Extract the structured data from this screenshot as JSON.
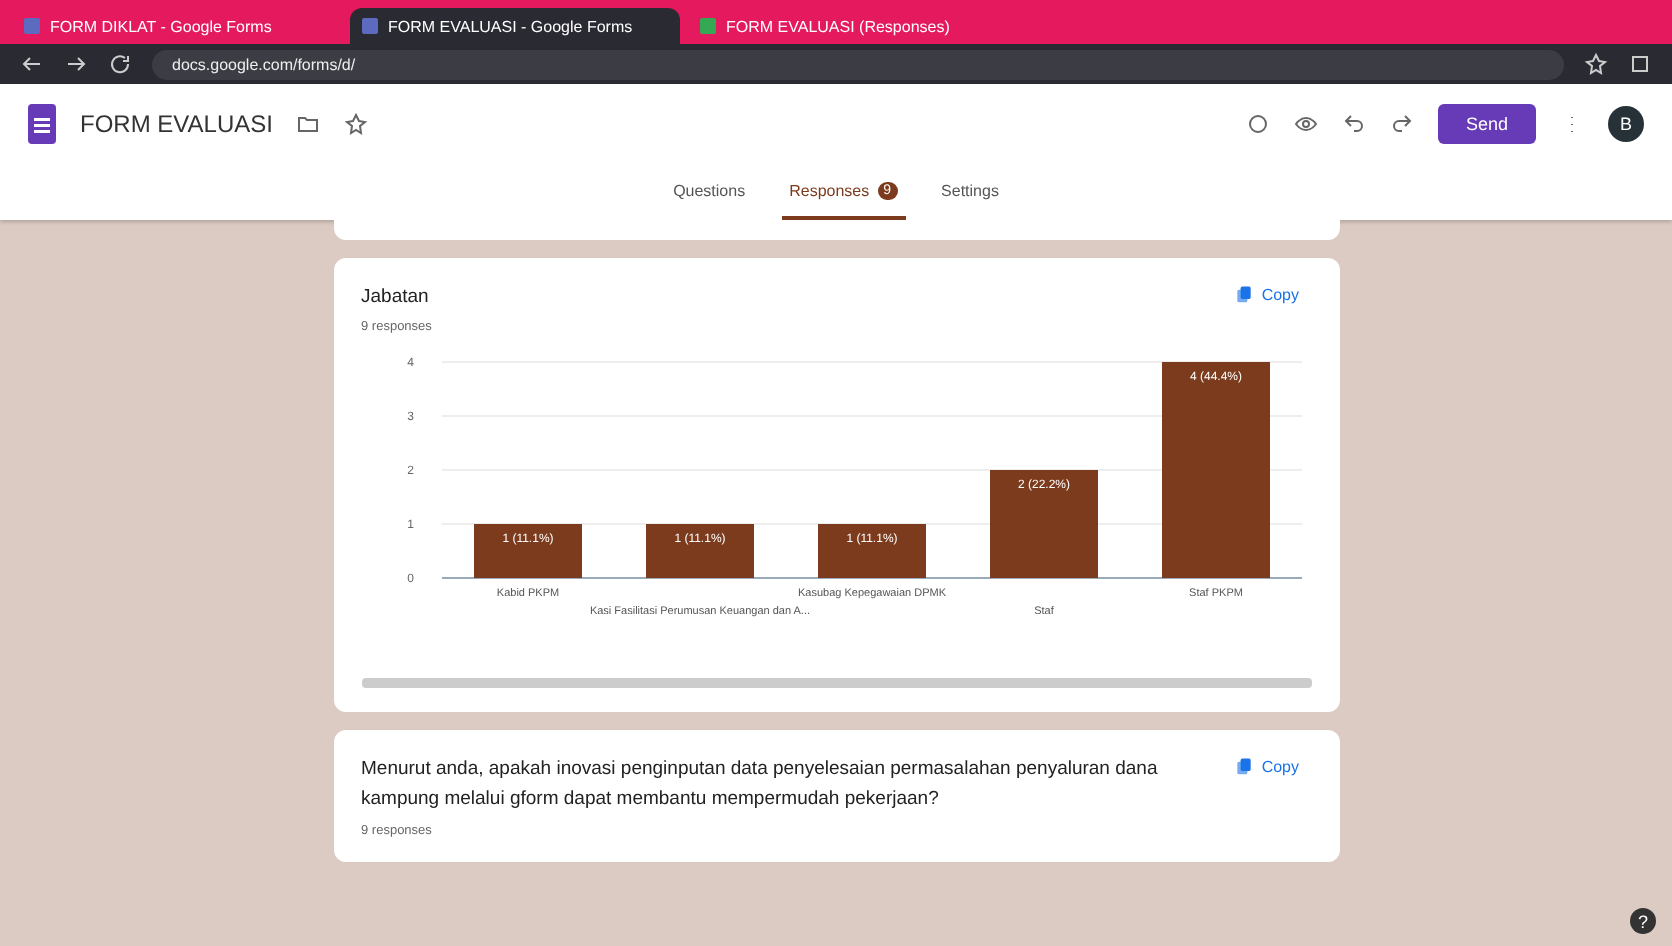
{
  "browser": {
    "tabs": [
      {
        "title": "FORM DIKLAT - Google Forms",
        "selected": false
      },
      {
        "title": "FORM EVALUASI - Google Forms",
        "selected": true
      },
      {
        "title": "FORM EVALUASI (Responses)",
        "selected": false
      }
    ],
    "url": "docs.google.com/forms/d/"
  },
  "header": {
    "title": "FORM EVALUASI",
    "send": "Send",
    "avatar": "B"
  },
  "tabs": [
    {
      "label": "Questions",
      "selected": false
    },
    {
      "label": "Responses",
      "selected": true,
      "badge": "9"
    },
    {
      "label": "Settings",
      "selected": false
    }
  ],
  "cards": [
    {
      "question": "Jabatan",
      "responses": "9 responses",
      "copy": "Copy",
      "chart_data": {
        "type": "bar",
        "categories": [
          "Kabid PKPM",
          "Kasi Fasilitasi Perumusan Keuangan dan A...",
          "Kasubag Kepegawaian DPMK",
          "Staf",
          "Staf PKPM"
        ],
        "series": [
          {
            "color": "#7b3b1c",
            "values": [
              1,
              1,
              1,
              2,
              4
            ]
          }
        ],
        "grid": true,
        "value_labels": [
          "1 (11.1%)",
          "1 (11.1%)",
          "1 (11.1%)",
          "2 (22.2%)",
          "4 (44.4%)"
        ],
        "ylim": [
          0,
          4
        ],
        "yticks": [
          0,
          1,
          2,
          3,
          4
        ]
      }
    },
    {
      "question": "Menurut anda, apakah inovasi penginputan data penyelesaian permasalahan penyaluran dana kampung melalui gform dapat membantu mempermudah pekerjaan?",
      "responses": "9 responses",
      "copy": "Copy"
    }
  ],
  "help": "?"
}
